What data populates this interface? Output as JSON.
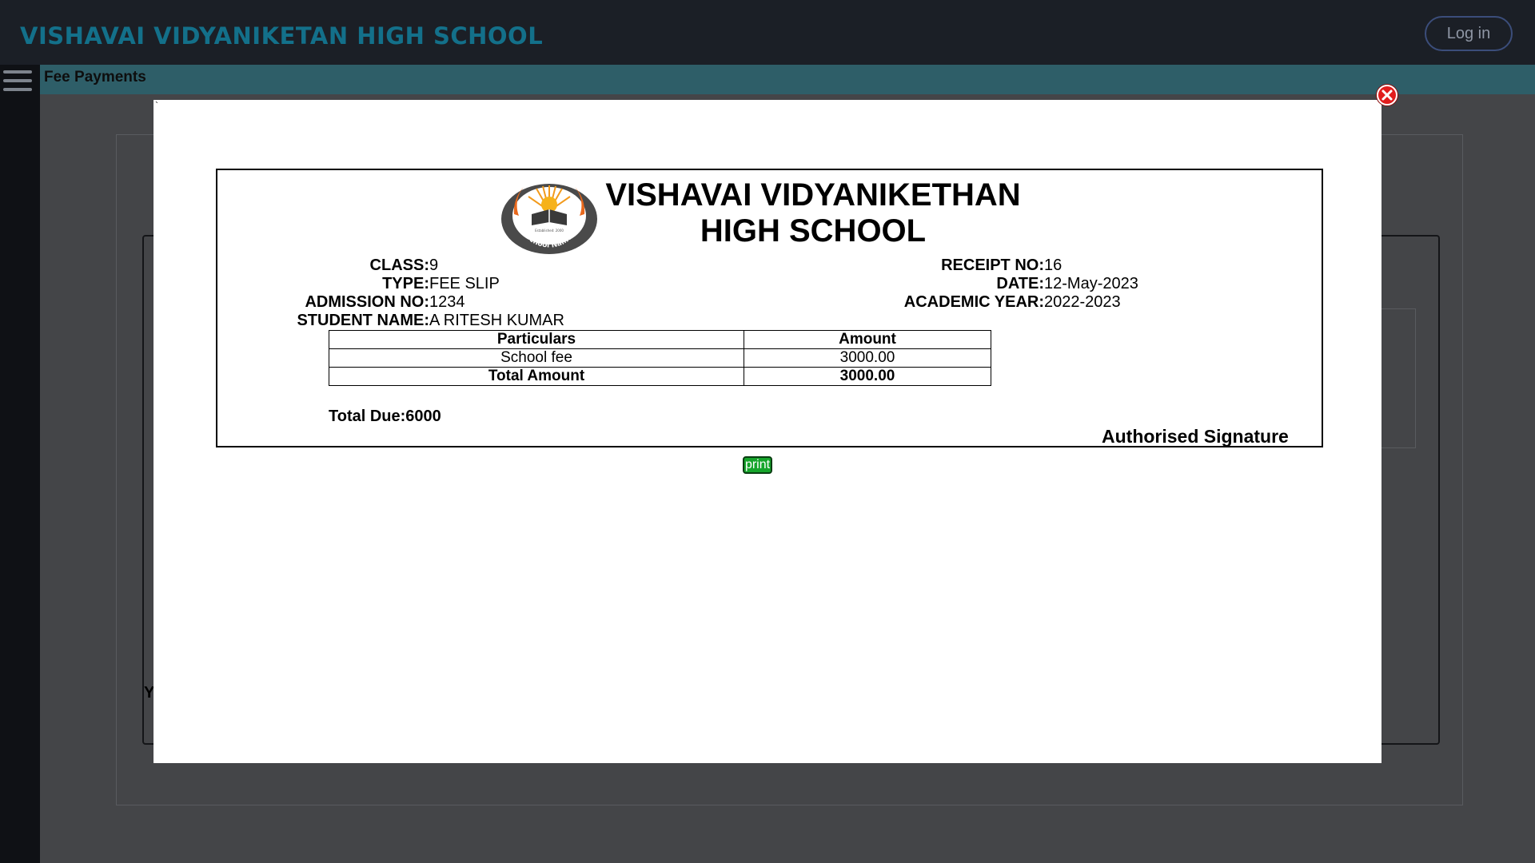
{
  "topbar": {
    "brand": "VISHAVAI VIDYANIKETAN HIGH SCHOOL",
    "login_label": "Log in"
  },
  "subheader": {
    "title": "Fee Payments"
  },
  "background": {
    "partial_letter": "Y"
  },
  "modal": {
    "tick": "`",
    "print_label": "print"
  },
  "receipt": {
    "school_line1": "VISHAVAI VIDYANIKETHAN",
    "school_line2": "HIGH SCHOOL",
    "logo_text": "Your School Name Here",
    "logo_small": "Established: 2000",
    "left": [
      {
        "label": "CLASS:",
        "value": "9"
      },
      {
        "label": "TYPE:",
        "value": "FEE SLIP"
      },
      {
        "label": "ADMISSION NO:",
        "value": "1234"
      },
      {
        "label": "STUDENT NAME:",
        "value": "A RITESH KUMAR"
      }
    ],
    "right": [
      {
        "label": "RECEIPT NO:",
        "value": "16"
      },
      {
        "label": "DATE:",
        "value": "12-May-2023"
      },
      {
        "label": "ACADEMIC YEAR:",
        "value": "2022-2023"
      }
    ],
    "table": {
      "headers": [
        "Particulars",
        "Amount"
      ],
      "rows": [
        {
          "particular": "School fee",
          "amount": "3000.00"
        }
      ],
      "total_label": "Total Amount",
      "total_amount": "3000.00"
    },
    "total_due": "Total Due:6000",
    "signature": "Authorised Signature"
  },
  "colors": {
    "brand": "#13708a",
    "subheader": "#2e5e68",
    "print_button": "#16a52b",
    "close_button": "#e11d1d"
  }
}
